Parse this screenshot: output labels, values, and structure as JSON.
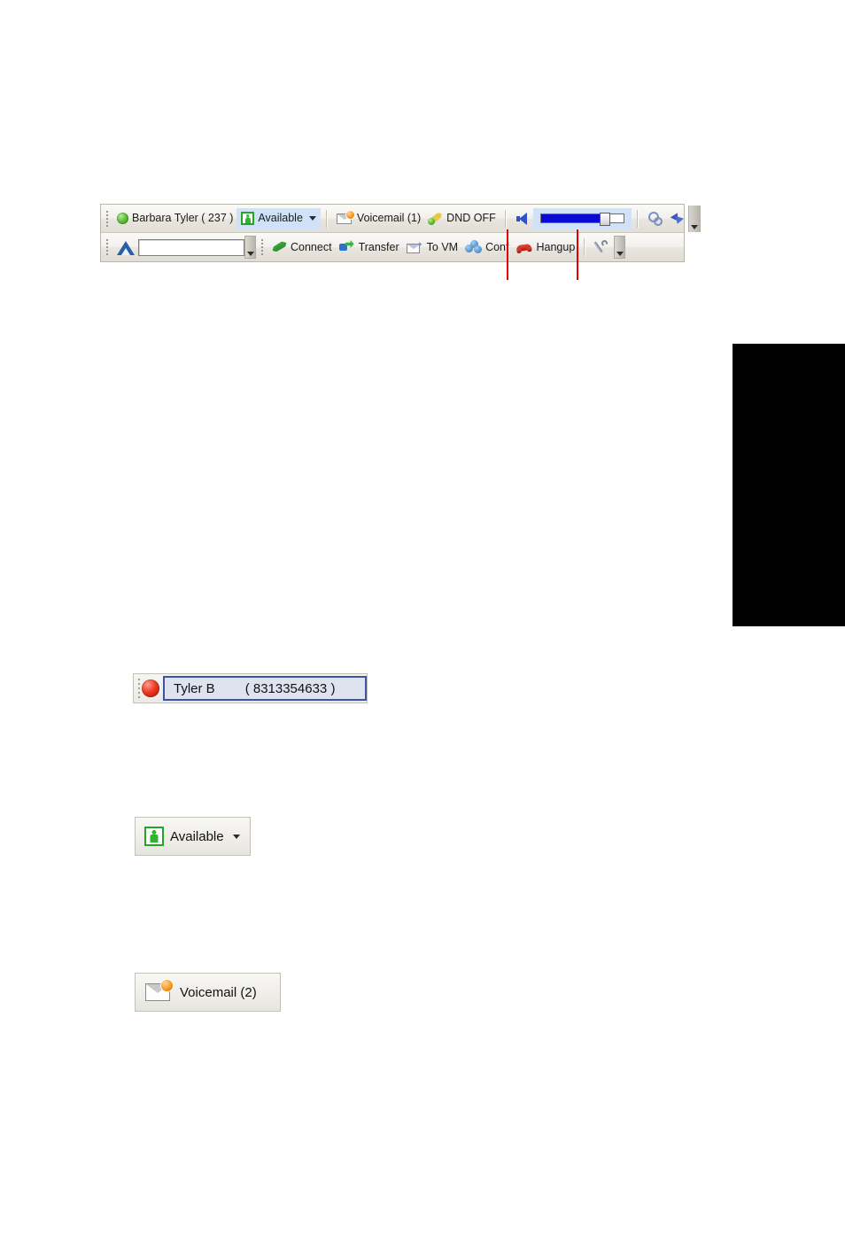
{
  "toolbar": {
    "row1": {
      "presence_dot": "green-status-dot",
      "user_label": "Barbara Tyler ( 237 )",
      "availability": {
        "label": "Available",
        "icon": "person-in-box-icon",
        "caret": "chevron-down-icon",
        "highlighted": true,
        "highlight_color": "#cfe2f7"
      },
      "voicemail_label": "Voicemail (1)",
      "dnd_label": "DND OFF",
      "speaker_icon": "speaker-icon",
      "volume": {
        "value_percent": 74,
        "fill_color": "#0a0ad2",
        "track_color": "#ffffff"
      },
      "right_tools": [
        "rings-icon",
        "arrow-tool-icon"
      ],
      "overflow": "chevron-down-icon"
    },
    "row2": {
      "dial_icon": "blue-triangle-icon",
      "dial_input_value": "",
      "dial_input_placeholder": "",
      "buttons": [
        {
          "label": "Connect",
          "icon": "green-handset-icon"
        },
        {
          "label": "Transfer",
          "icon": "transfer-arrows-icon"
        },
        {
          "label": "To VM",
          "icon": "to-voicemail-icon"
        },
        {
          "label": "Conf",
          "icon": "conference-icon"
        },
        {
          "label": "Hangup",
          "icon": "red-handset-icon"
        }
      ],
      "settings_icon": "wrench-icon",
      "overflow": "chevron-down-icon"
    }
  },
  "annotations": {
    "line_color": "#e60000",
    "lines": [
      {
        "name": "speaker-callout-line"
      },
      {
        "name": "volume-slider-callout-line"
      }
    ]
  },
  "callouts": {
    "tyler": {
      "status_dot": "red-status-dot",
      "name": "Tyler B",
      "number": "( 8313354633 )"
    },
    "available": {
      "icon": "person-in-box-icon",
      "label": "Available",
      "caret": "chevron-down-icon"
    },
    "voicemail": {
      "icon": "envelope-with-badge-icon",
      "label": "Voicemail (2)"
    }
  },
  "redaction": {
    "name": "black-block",
    "color": "#000000"
  }
}
